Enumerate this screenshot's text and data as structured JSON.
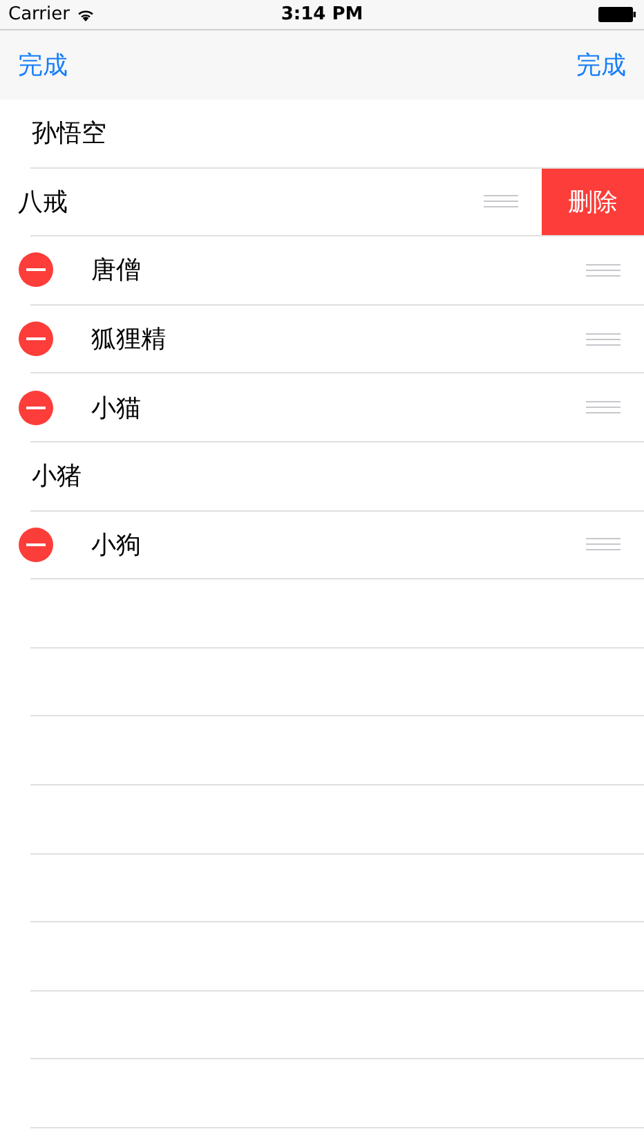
{
  "status_bar": {
    "carrier": "Carrier",
    "time": "3:14 PM"
  },
  "nav_bar": {
    "left_button": "完成",
    "right_button": "完成"
  },
  "rows": [
    {
      "kind": "plain",
      "label": "孙悟空"
    },
    {
      "kind": "swiped",
      "label": "八戒",
      "action": "删除"
    },
    {
      "kind": "editing",
      "label": "唐僧"
    },
    {
      "kind": "editing",
      "label": "狐狸精"
    },
    {
      "kind": "editing",
      "label": "小猫"
    },
    {
      "kind": "plain",
      "label": "小猪"
    },
    {
      "kind": "editing",
      "label": "小狗"
    }
  ]
}
